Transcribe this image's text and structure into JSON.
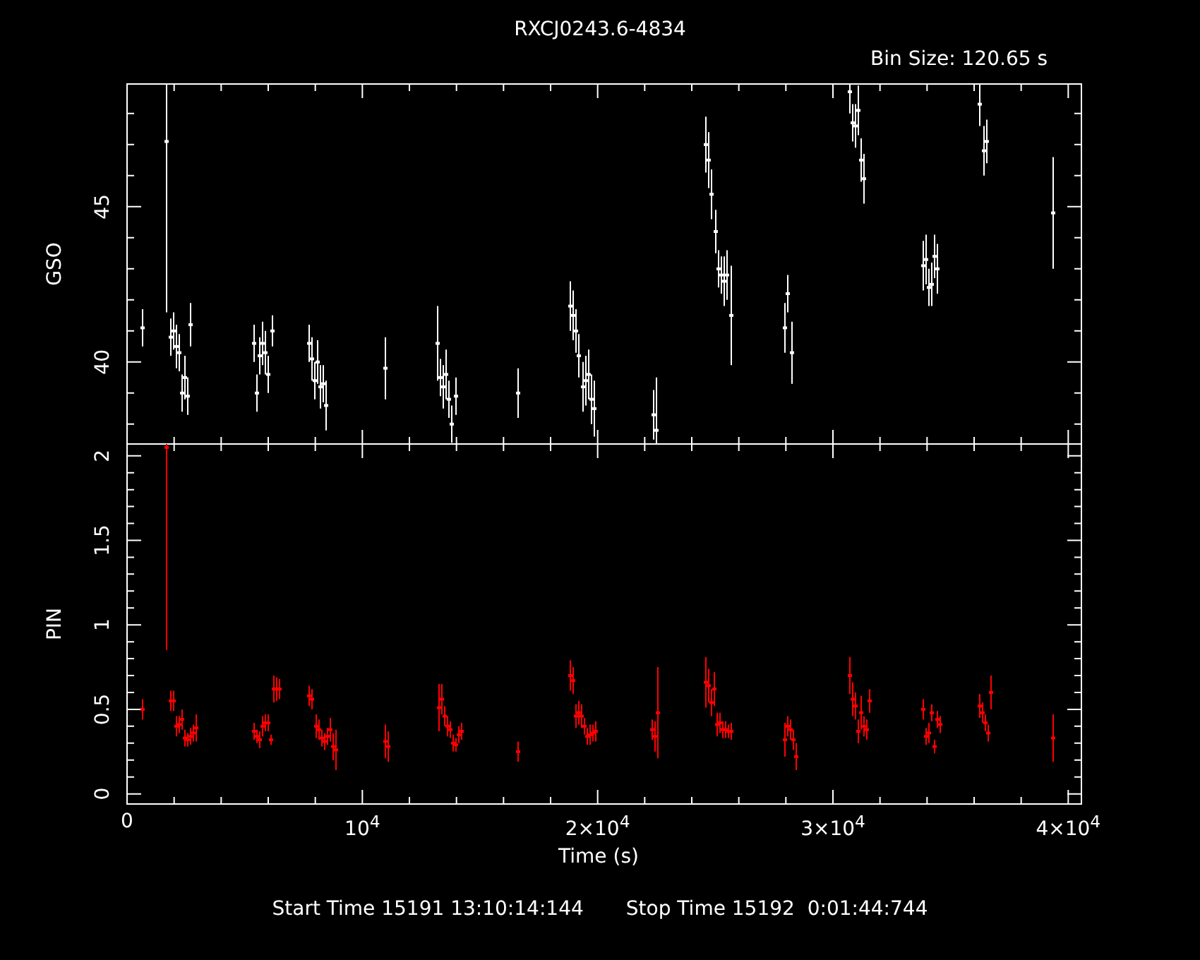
{
  "title": "RXCJ0243.6-4834",
  "bin_size": "Bin Size: 120.65 s",
  "panels": [
    {
      "chart_data": {
        "type": "scatter",
        "ylabel": "GSO",
        "xlim": [
          0,
          40560
        ],
        "ylim": [
          37.36,
          48.95
        ],
        "yticks": [
          {
            "value": 40,
            "label": "40"
          },
          {
            "value": 45,
            "label": "45"
          }
        ],
        "x": [
          660,
          1680,
          1860,
          1980,
          2100,
          2220,
          2340,
          2460,
          2580,
          2700,
          5400,
          5520,
          5640,
          5760,
          5880,
          6000,
          6180,
          7740,
          7860,
          7980,
          8100,
          8220,
          8340,
          8460,
          10980,
          13200,
          13320,
          13440,
          13560,
          13680,
          13800,
          13980,
          16620,
          18840,
          18960,
          19080,
          19200,
          19380,
          19500,
          19620,
          19740,
          19860,
          22380,
          22500,
          24600,
          24720,
          24840,
          25020,
          25140,
          25260,
          25380,
          25500,
          25680,
          27960,
          28080,
          28260,
          30720,
          30840,
          30960,
          31080,
          31200,
          31320,
          33840,
          33960,
          34080,
          34200,
          34320,
          34440,
          36240,
          36420,
          36540,
          39360
        ],
        "series": [
          {
            "color": "#ffffff",
            "values": [
              41.1,
              47.1,
              40.8,
              41.0,
              40.5,
              40.3,
              39.0,
              39.5,
              38.9,
              41.2,
              40.6,
              39.0,
              40.2,
              40.6,
              40.3,
              39.6,
              41.0,
              40.6,
              40.1,
              39.4,
              40.0,
              39.2,
              39.3,
              38.6,
              39.8,
              40.6,
              39.5,
              39.2,
              39.6,
              38.8,
              38.0,
              38.9,
              39.0,
              41.8,
              41.5,
              41.0,
              40.2,
              39.2,
              39.4,
              39.6,
              38.8,
              38.5,
              38.3,
              37.8,
              47.0,
              46.5,
              45.4,
              44.2,
              43.0,
              42.8,
              42.6,
              42.8,
              41.5,
              41.1,
              42.2,
              40.3,
              48.7,
              47.7,
              47.6,
              48.1,
              46.5,
              45.9,
              43.1,
              43.3,
              42.4,
              42.5,
              43.4,
              43.0,
              48.3,
              46.8,
              47.1,
              44.8
            ],
            "errors": [
              0.6,
              5.5,
              0.6,
              0.6,
              0.7,
              0.6,
              0.6,
              0.7,
              0.6,
              0.7,
              0.6,
              0.6,
              0.6,
              0.7,
              0.7,
              0.6,
              0.5,
              0.6,
              0.7,
              0.6,
              0.7,
              0.7,
              0.6,
              0.8,
              1.0,
              1.2,
              0.6,
              0.7,
              0.8,
              0.6,
              0.6,
              0.6,
              0.8,
              0.8,
              0.8,
              0.7,
              0.7,
              0.8,
              0.8,
              0.8,
              0.8,
              0.9,
              0.8,
              1.7,
              0.9,
              0.9,
              0.8,
              0.7,
              0.6,
              0.6,
              0.8,
              0.8,
              1.6,
              0.8,
              0.6,
              1.0,
              0.7,
              0.6,
              0.7,
              0.8,
              0.7,
              0.8,
              0.8,
              0.8,
              0.6,
              0.7,
              0.7,
              0.8,
              0.7,
              0.8,
              0.7,
              1.8
            ]
          }
        ]
      }
    },
    {
      "chart_data": {
        "type": "scatter",
        "ylabel": "PIN",
        "xlabel": "Time (s)",
        "xlim": [
          0,
          40560
        ],
        "ylim": [
          -0.06,
          2.07
        ],
        "xticks": [
          {
            "value": 0,
            "label": "0"
          },
          {
            "value": 10000,
            "label": "10$^{4}$"
          },
          {
            "value": 20000,
            "label": "2×10$^{4}$"
          },
          {
            "value": 30000,
            "label": "3×10$^{4}$"
          },
          {
            "value": 40000,
            "label": "4×10$^{4}$"
          }
        ],
        "yticks": [
          {
            "value": 0,
            "label": "0"
          },
          {
            "value": 0.5,
            "label": "0.5"
          },
          {
            "value": 1,
            "label": "1"
          },
          {
            "value": 1.5,
            "label": "1.5"
          },
          {
            "value": 2,
            "label": "2"
          }
        ],
        "x": [
          660,
          1680,
          1860,
          1980,
          2100,
          2220,
          2340,
          2460,
          2580,
          2700,
          2820,
          2940,
          5400,
          5520,
          5640,
          5760,
          5880,
          6000,
          6120,
          6240,
          6360,
          6480,
          7740,
          7860,
          8040,
          8160,
          8280,
          8400,
          8520,
          8640,
          8760,
          8880,
          10980,
          11100,
          13260,
          13380,
          13500,
          13620,
          13740,
          13860,
          13980,
          14100,
          14220,
          16620,
          18840,
          18960,
          19080,
          19200,
          19320,
          19440,
          19560,
          19680,
          19800,
          19920,
          22320,
          22440,
          22560,
          24600,
          24720,
          24840,
          24960,
          25080,
          25200,
          25320,
          25440,
          25560,
          25680,
          27960,
          28080,
          28200,
          28320,
          28440,
          30720,
          30840,
          30960,
          31080,
          31200,
          31320,
          31440,
          31560,
          33840,
          33960,
          34080,
          34200,
          34320,
          34440,
          34560,
          36240,
          36360,
          36480,
          36600,
          36720,
          39360
        ],
        "series": [
          {
            "color": "#ff0000",
            "values": [
              0.5,
              2.05,
              0.55,
              0.55,
              0.4,
              0.41,
              0.44,
              0.33,
              0.32,
              0.34,
              0.36,
              0.39,
              0.37,
              0.34,
              0.32,
              0.4,
              0.42,
              0.42,
              0.32,
              0.62,
              0.62,
              0.62,
              0.58,
              0.56,
              0.4,
              0.38,
              0.33,
              0.31,
              0.34,
              0.38,
              0.28,
              0.26,
              0.31,
              0.28,
              0.51,
              0.56,
              0.46,
              0.4,
              0.38,
              0.3,
              0.29,
              0.35,
              0.37,
              0.25,
              0.7,
              0.67,
              0.46,
              0.48,
              0.46,
              0.4,
              0.34,
              0.35,
              0.36,
              0.37,
              0.38,
              0.34,
              0.48,
              0.66,
              0.64,
              0.54,
              0.62,
              0.41,
              0.42,
              0.38,
              0.38,
              0.37,
              0.37,
              0.32,
              0.4,
              0.38,
              0.32,
              0.22,
              0.7,
              0.56,
              0.52,
              0.37,
              0.48,
              0.4,
              0.38,
              0.55,
              0.5,
              0.34,
              0.36,
              0.48,
              0.28,
              0.44,
              0.41,
              0.52,
              0.48,
              0.42,
              0.36,
              0.6,
              0.33
            ],
            "errors": [
              0.06,
              1.2,
              0.06,
              0.06,
              0.06,
              0.05,
              0.06,
              0.05,
              0.04,
              0.05,
              0.05,
              0.08,
              0.05,
              0.04,
              0.05,
              0.06,
              0.05,
              0.05,
              0.03,
              0.08,
              0.07,
              0.06,
              0.06,
              0.06,
              0.07,
              0.06,
              0.05,
              0.05,
              0.05,
              0.07,
              0.08,
              0.12,
              0.1,
              0.09,
              0.14,
              0.09,
              0.06,
              0.06,
              0.05,
              0.05,
              0.04,
              0.05,
              0.05,
              0.06,
              0.09,
              0.08,
              0.07,
              0.07,
              0.07,
              0.05,
              0.05,
              0.06,
              0.05,
              0.06,
              0.06,
              0.09,
              0.27,
              0.15,
              0.1,
              0.08,
              0.1,
              0.07,
              0.06,
              0.05,
              0.05,
              0.04,
              0.05,
              0.1,
              0.06,
              0.06,
              0.06,
              0.08,
              0.11,
              0.1,
              0.08,
              0.07,
              0.1,
              0.06,
              0.06,
              0.07,
              0.06,
              0.05,
              0.06,
              0.05,
              0.04,
              0.05,
              0.05,
              0.07,
              0.06,
              0.05,
              0.05,
              0.1,
              0.14
            ]
          }
        ]
      }
    }
  ],
  "footer": {
    "start": "Start Time 15191 13:10:14:144",
    "stop": "Stop Time 15192  0:01:44:744"
  }
}
